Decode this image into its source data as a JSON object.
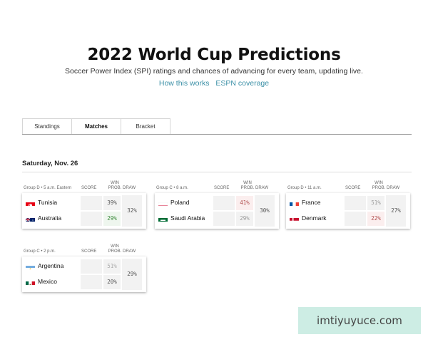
{
  "header": {
    "title": "2022 World Cup Predictions",
    "subtitle": "Soccer Power Index (SPI) ratings and chances of advancing for every team, updating live.",
    "link_how": "How this works",
    "link_espn": "ESPN coverage"
  },
  "tabs": [
    {
      "label": "Standings"
    },
    {
      "label": "Matches"
    },
    {
      "label": "Bracket"
    }
  ],
  "date_heading": "Saturday, Nov. 26",
  "col_headers": {
    "score": "SCORE",
    "win_line1": "WIN",
    "win_line2": "PROB.",
    "draw": "DRAW"
  },
  "matches": [
    {
      "group_time": "Group D • 5 a.m. Eastern",
      "team1": {
        "name": "Tunisia",
        "win": "39%",
        "win_color": "#555555",
        "win_bg": "#f2f2f2",
        "flag": "tunisia-flag-icon"
      },
      "team2": {
        "name": "Australia",
        "win": "29%",
        "win_color": "#3a8a3a",
        "win_bg": "#eef6ee",
        "flag": "australia-flag-icon"
      },
      "draw": "32%"
    },
    {
      "group_time": "Group C • 8 a.m.",
      "team1": {
        "name": "Poland",
        "win": "41%",
        "win_color": "#b04a4a",
        "win_bg": "#fbeeee",
        "flag": "poland-flag-icon"
      },
      "team2": {
        "name": "Saudi Arabia",
        "win": "29%",
        "win_color": "#999999",
        "win_bg": "#f2f2f2",
        "flag": "saudi-arabia-flag-icon"
      },
      "draw": "30%"
    },
    {
      "group_time": "Group D • 11 a.m.",
      "team1": {
        "name": "France",
        "win": "51%",
        "win_color": "#999999",
        "win_bg": "#f2f2f2",
        "flag": "france-flag-icon"
      },
      "team2": {
        "name": "Denmark",
        "win": "22%",
        "win_color": "#b04a4a",
        "win_bg": "#fbeeee",
        "flag": "denmark-flag-icon"
      },
      "draw": "27%"
    },
    {
      "group_time": "Group C • 2 p.m.",
      "team1": {
        "name": "Argentina",
        "win": "51%",
        "win_color": "#aaaaaa",
        "win_bg": "#f2f2f2",
        "flag": "argentina-flag-icon"
      },
      "team2": {
        "name": "Mexico",
        "win": "20%",
        "win_color": "#555555",
        "win_bg": "#f2f2f2",
        "flag": "mexico-flag-icon"
      },
      "draw": "29%"
    }
  ],
  "watermark": "imtiyuyuce.com"
}
